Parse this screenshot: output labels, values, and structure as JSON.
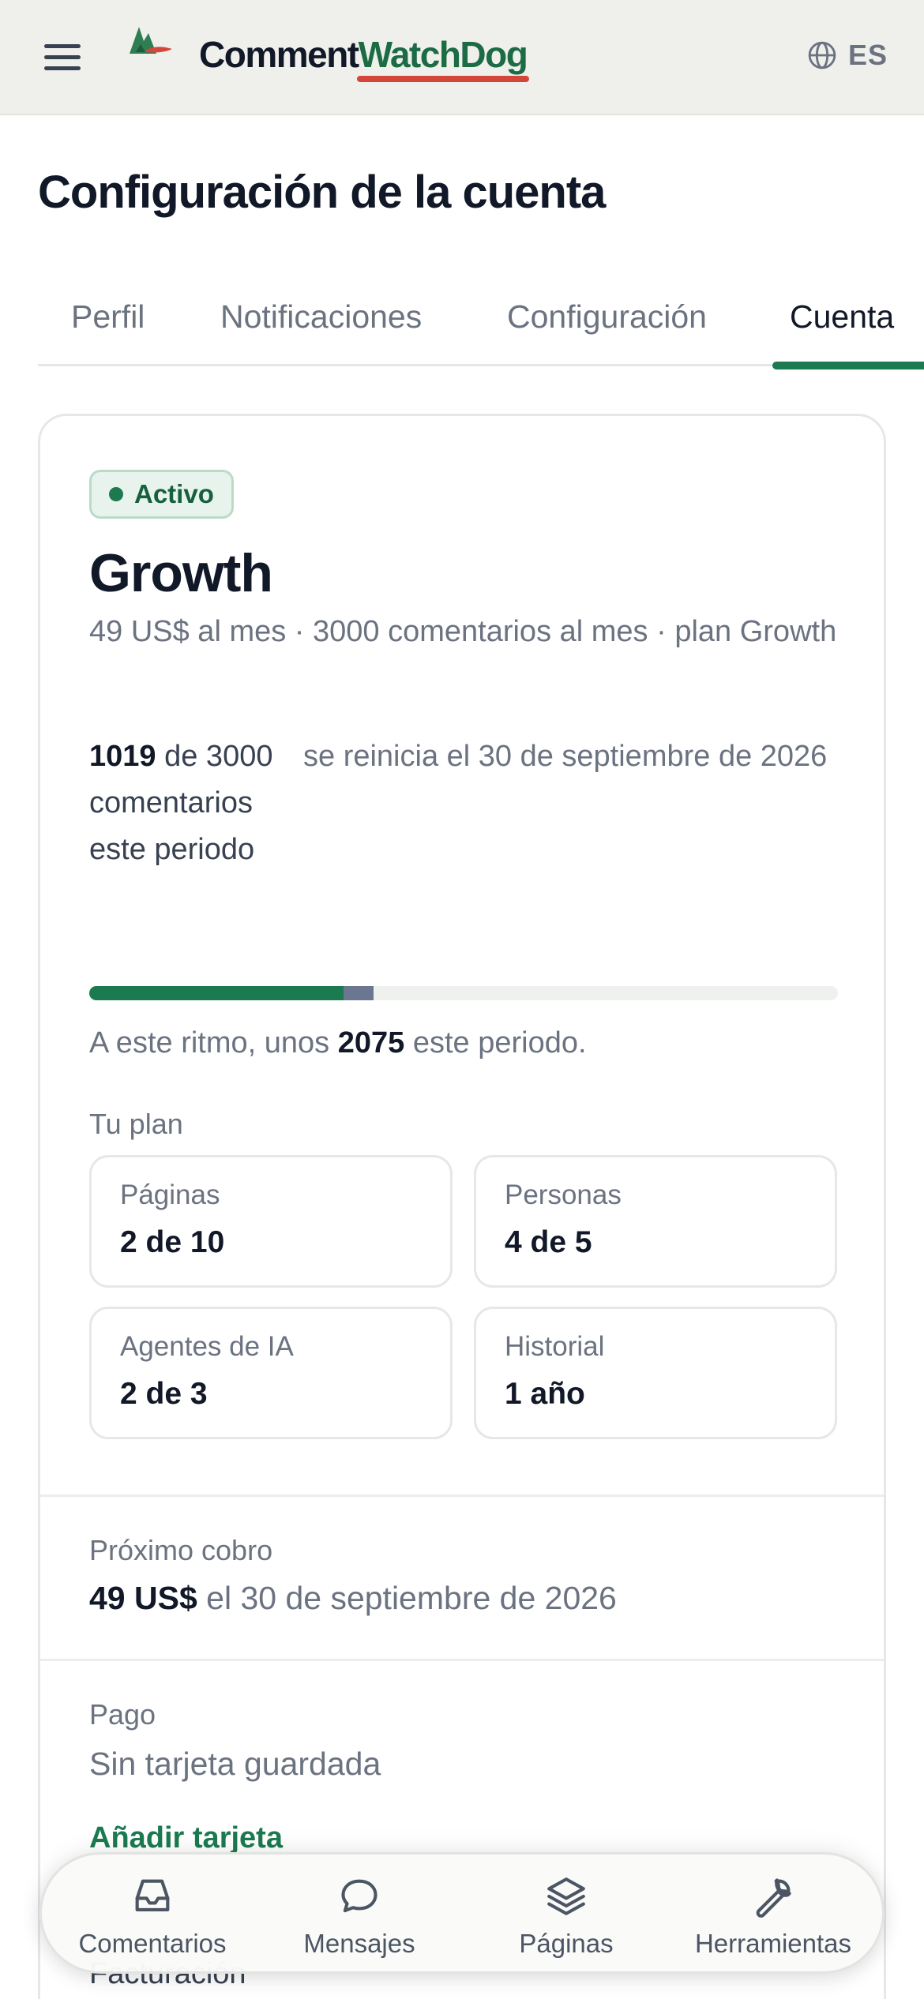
{
  "header": {
    "logo_part1": "Comment",
    "logo_part2": "WatchDog",
    "language": "ES"
  },
  "page": {
    "title": "Configuración de la cuenta"
  },
  "tabs": [
    {
      "label": "Perfil",
      "active": false
    },
    {
      "label": "Notificaciones",
      "active": false
    },
    {
      "label": "Configuración",
      "active": false
    },
    {
      "label": "Cuenta",
      "active": true
    }
  ],
  "plan": {
    "status": "Activo",
    "name": "Growth",
    "description": "49 US$ al mes · 3000 comentarios al mes · plan Growth",
    "usage_used": "1019",
    "usage_rest": " de 3000 comentarios este periodo",
    "reset_text": "se reinicia el 30 de septiembre de 2026",
    "usage_fraction": 0.34,
    "projected_fraction": 0.38,
    "pace_prefix": "A este ritmo, unos ",
    "pace_value": "2075",
    "pace_suffix": " este periodo.",
    "section_label": "Tu plan",
    "tiles": [
      {
        "label": "Páginas",
        "value": "2 de 10"
      },
      {
        "label": "Personas",
        "value": "4 de 5"
      },
      {
        "label": "Agentes de IA",
        "value": "2 de 3"
      },
      {
        "label": "Historial",
        "value": "1 año"
      }
    ]
  },
  "next_charge": {
    "label": "Próximo cobro",
    "amount": "49 US$",
    "date_text": " el 30 de septiembre de 2026"
  },
  "payment": {
    "label": "Pago",
    "value": "Sin tarjeta guardada",
    "add_card": "Añadir tarjeta"
  },
  "billing": {
    "label": "Facturación"
  },
  "bottom_nav": [
    {
      "label": "Comentarios",
      "icon": "inbox-icon"
    },
    {
      "label": "Mensajes",
      "icon": "chat-bubble-icon"
    },
    {
      "label": "Páginas",
      "icon": "layers-icon"
    },
    {
      "label": "Herramientas",
      "icon": "wrench-icon"
    }
  ],
  "colors": {
    "brand_green": "#1b7a50",
    "logo_accent_red": "#d4463a",
    "header_bg": "#eff0ec",
    "projected_bar": "#6b7690"
  }
}
